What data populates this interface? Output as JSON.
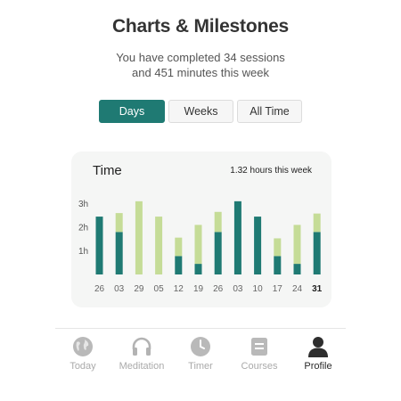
{
  "header": {
    "title": "Charts & Milestones",
    "subtitle_line1": "You have completed 34 sessions",
    "subtitle_line2": "and 451 minutes this week"
  },
  "segments": {
    "options": [
      "Days",
      "Weeks",
      "All Time"
    ],
    "selected": "Days"
  },
  "card": {
    "title": "Time",
    "summary": "1.32 hours this week"
  },
  "colors": {
    "accent": "#1f7a73",
    "bar_dark": "#1f7a73",
    "bar_light": "#c5dc97",
    "nav_inactive": "#aaaaaa",
    "nav_active": "#2a2a2a"
  },
  "chart_data": {
    "type": "bar",
    "stacked": true,
    "categories": [
      "26",
      "03",
      "29",
      "05",
      "12",
      "19",
      "26",
      "03",
      "10",
      "17",
      "24",
      "31"
    ],
    "highlighted_category_index": 11,
    "y_ticks": [
      "1h",
      "2h",
      "3h"
    ],
    "ylim": [
      0,
      3.3
    ],
    "series": [
      {
        "color": "#1f7a73",
        "values": [
          2.45,
          1.8,
          0,
          0,
          0.78,
          0.45,
          1.8,
          3.1,
          2.45,
          0.78,
          0.45,
          1.8
        ]
      },
      {
        "color": "#c5dc97",
        "values": [
          0,
          0.8,
          3.1,
          2.45,
          0.78,
          1.65,
          0.85,
          0,
          0,
          0.75,
          1.65,
          0.78
        ]
      }
    ],
    "grid": false
  },
  "nav": {
    "items": [
      {
        "label": "Today",
        "icon": "globe-icon",
        "active": false
      },
      {
        "label": "Meditation",
        "icon": "headphones-icon",
        "active": false
      },
      {
        "label": "Timer",
        "icon": "clock-icon",
        "active": false
      },
      {
        "label": "Courses",
        "icon": "document-icon",
        "active": false
      },
      {
        "label": "Profile",
        "icon": "person-icon",
        "active": true
      }
    ]
  }
}
